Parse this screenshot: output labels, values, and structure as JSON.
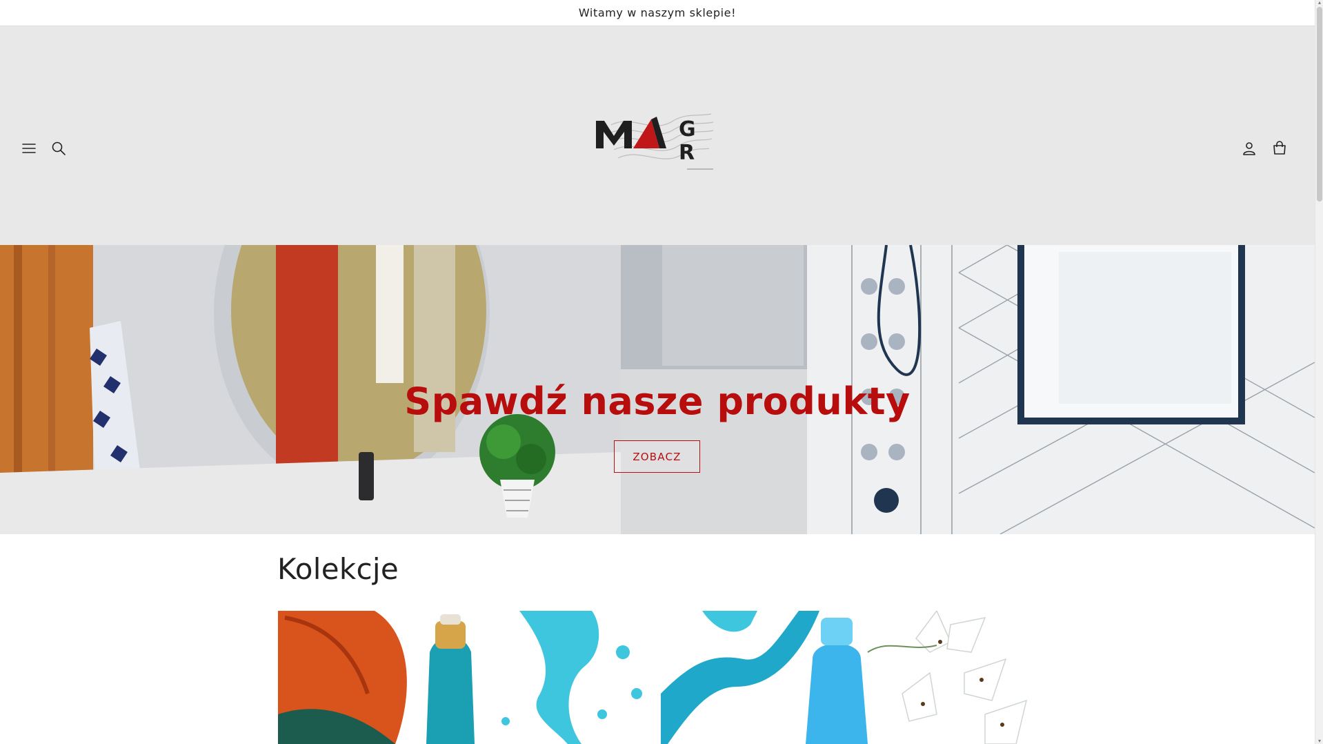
{
  "announcement": {
    "text": "Witamy w naszym sklepie!"
  },
  "header": {
    "icons": [
      "menu-icon",
      "search-icon",
      "account-icon",
      "cart-icon"
    ],
    "logo_alt": "MAGR"
  },
  "hero": {
    "title": "Spawdź nasze produkty",
    "button_label": "ZOBACZ",
    "accent_color": "#b70d0d"
  },
  "collections": {
    "title": "Kolekcje",
    "cards": [
      {
        "image": "laundry-detergent-image"
      },
      {
        "image": "cleaning-liquid-image"
      }
    ]
  }
}
